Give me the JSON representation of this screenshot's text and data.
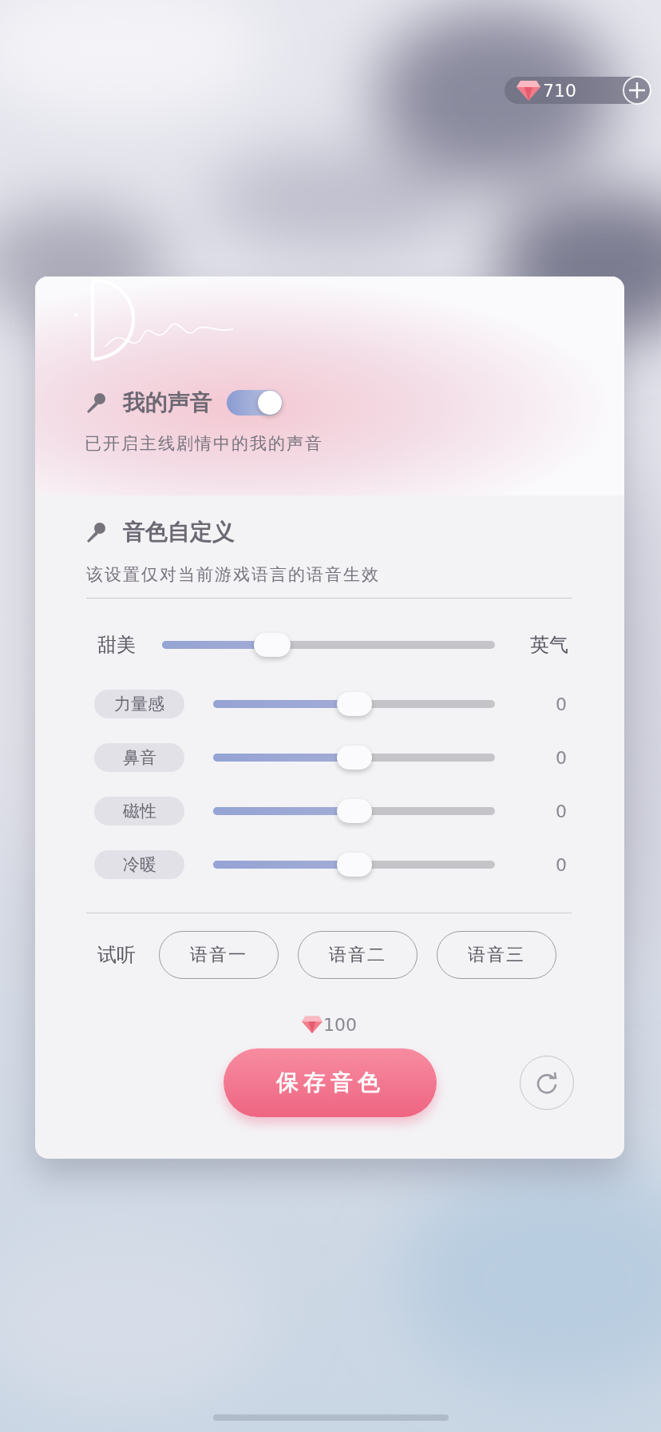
{
  "currency": {
    "amount": "710"
  },
  "my_voice": {
    "title": "我的声音",
    "on": true,
    "description": "已开启主线剧情中的我的声音"
  },
  "timbre": {
    "title": "音色自定义",
    "description": "该设置仅对当前游戏语言的语音生效",
    "main_slider": {
      "left_label": "甜美",
      "right_label": "英气",
      "level": 0.33
    },
    "adjustments": [
      {
        "label": "力量感",
        "level": 0.5,
        "reading": "0"
      },
      {
        "label": "鼻音",
        "level": 0.5,
        "reading": "0"
      },
      {
        "label": "磁性",
        "level": 0.5,
        "reading": "0"
      },
      {
        "label": "冷暖",
        "level": 0.5,
        "reading": "0"
      }
    ]
  },
  "preview": {
    "label": "试听",
    "buttons": [
      "语音一",
      "语音二",
      "语音三"
    ]
  },
  "cost": "100",
  "save_button": "保存音色"
}
